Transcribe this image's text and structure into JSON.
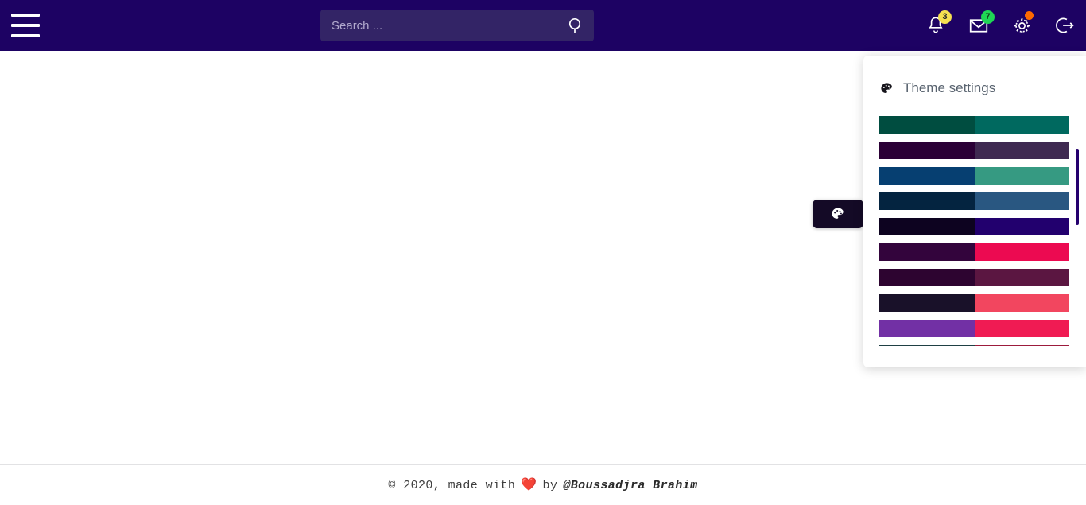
{
  "header": {
    "menu_icon": "hamburger-menu-icon",
    "background_color": "#1d0263",
    "search": {
      "placeholder": "Search ...",
      "value": "",
      "icon": "search-icon"
    },
    "actions": [
      {
        "name": "notifications",
        "icon": "bell-icon",
        "badge": "3",
        "badge_style": "warning",
        "badge_color": "#f5e050"
      },
      {
        "name": "messages",
        "icon": "envelope-icon",
        "badge": "7",
        "badge_style": "success",
        "badge_color": "#1fd655"
      },
      {
        "name": "settings",
        "icon": "gear-icon",
        "badge": "",
        "badge_style": "dot",
        "badge_color": "#ff6a00"
      },
      {
        "name": "logout",
        "icon": "logout-icon",
        "badge": "",
        "badge_style": "none",
        "badge_color": ""
      }
    ]
  },
  "theme_fab": {
    "icon": "palette-icon",
    "background_color": "#140a26"
  },
  "theme_panel": {
    "title": "Theme settings",
    "icon": "palette-icon",
    "scrollbar_color": "#25006e",
    "themes": [
      {
        "name": "theme-teal-dark",
        "primary": "#004d40",
        "secondary": "#00695f"
      },
      {
        "name": "theme-plum-dark",
        "primary": "#2b0036",
        "secondary": "#3f2951"
      },
      {
        "name": "theme-blue-green",
        "primary": "#063f71",
        "secondary": "#369a82"
      },
      {
        "name": "theme-navy-steel",
        "primary": "#042440",
        "secondary": "#295781"
      },
      {
        "name": "theme-black-indigo",
        "primary": "#0d0320",
        "secondary": "#22006e"
      },
      {
        "name": "theme-plum-crimson",
        "primary": "#33043c",
        "secondary": "#ec0a51"
      },
      {
        "name": "theme-plum-wine",
        "primary": "#2d0430",
        "secondary": "#5b1641"
      },
      {
        "name": "theme-ink-rose",
        "primary": "#191129",
        "secondary": "#f2465f"
      },
      {
        "name": "theme-violet-pink",
        "primary": "#7230a5",
        "secondary": "#f01b53"
      },
      {
        "name": "theme-teal-maroon",
        "primary": "#1f4044",
        "secondary": "#9c1b3c"
      }
    ]
  },
  "footer": {
    "copyright": "© 2020, made with",
    "heart": "❤️",
    "by": "by",
    "author": "@Boussadjra Brahim"
  }
}
